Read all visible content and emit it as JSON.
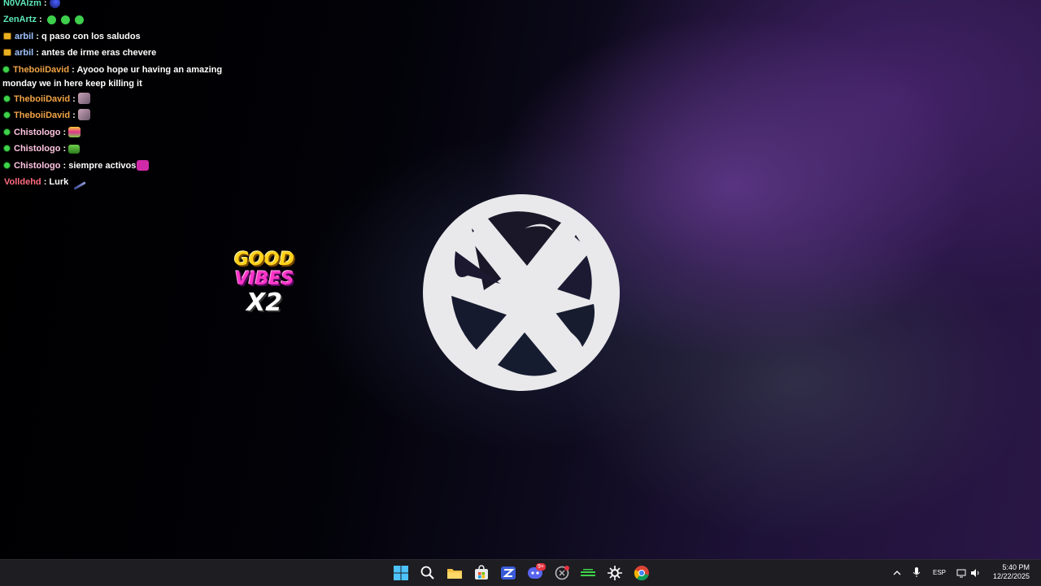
{
  "chat": {
    "messages": [
      {
        "user": "N0VAlzm",
        "user_color": "#5de8b9",
        "sep": " :",
        "text": "",
        "badge": "none",
        "emotes": [
          "blue"
        ]
      },
      {
        "user": "ZenArtz",
        "user_color": "#5de8b9",
        "sep": " :",
        "text": "",
        "badge": "none",
        "emotes": [
          "green",
          "green",
          "green"
        ]
      },
      {
        "user": "arbil",
        "user_color": "#9fc3ff",
        "sep": " :",
        "text": " q paso con los saludos",
        "badge": "gold",
        "emotes": []
      },
      {
        "user": "arbil",
        "user_color": "#9fc3ff",
        "sep": " :",
        "text": " antes de irme eras chevere",
        "badge": "gold",
        "emotes": []
      },
      {
        "user": "TheboiiDavid",
        "user_color": "#f2a446",
        "sep": " :",
        "text": " Ayooo hope ur having an amazing monday we in here keep killing it",
        "badge": "green",
        "emotes": []
      },
      {
        "user": "TheboiiDavid",
        "user_color": "#f2a446",
        "sep": " :",
        "text": "",
        "badge": "green",
        "emotes": [
          "photo"
        ]
      },
      {
        "user": "TheboiiDavid",
        "user_color": "#f2a446",
        "sep": " :",
        "text": "",
        "badge": "green",
        "emotes": [
          "photo"
        ]
      },
      {
        "user": "Chistologo",
        "user_color": "#ffc4e1",
        "sep": " :",
        "text": "",
        "badge": "green",
        "emotes": [
          "multi"
        ]
      },
      {
        "user": "Chistologo",
        "user_color": "#ffc4e1",
        "sep": " :",
        "text": "",
        "badge": "green",
        "emotes": [
          "frog"
        ]
      },
      {
        "user": "Chistologo",
        "user_color": "#ffc4e1",
        "sep": " :",
        "text": " siempre activos",
        "badge": "green",
        "emotes": [
          "pink"
        ]
      },
      {
        "user": "Volldehd",
        "user_color": "#ff6b7f",
        "sep": " :",
        "text": " Lurk",
        "badge": "none",
        "emotes": [
          "wand"
        ]
      }
    ]
  },
  "sticker": {
    "line1": "GOOD",
    "line2": "VIBES",
    "line3": "X2"
  },
  "desktop": {
    "logo_icon": "stylized-x-circle-logo",
    "logo_color": "#e9e9ec"
  },
  "taskbar": {
    "icons": [
      "windows-start-icon",
      "search-icon",
      "file-explorer-icon",
      "microsoft-store-icon",
      "app-icon",
      "discord-icon",
      "app-icon-2",
      "monitor-app-icon",
      "steam-icon",
      "chrome-icon"
    ],
    "discord_badge": "9+",
    "language": "ESP",
    "time": "5:40 PM",
    "date": "12/22/2025"
  },
  "colors": {
    "taskbar_bg": "#1e1d22",
    "badge_green": "#3fd34a",
    "badge_gold": "#e8b020"
  }
}
